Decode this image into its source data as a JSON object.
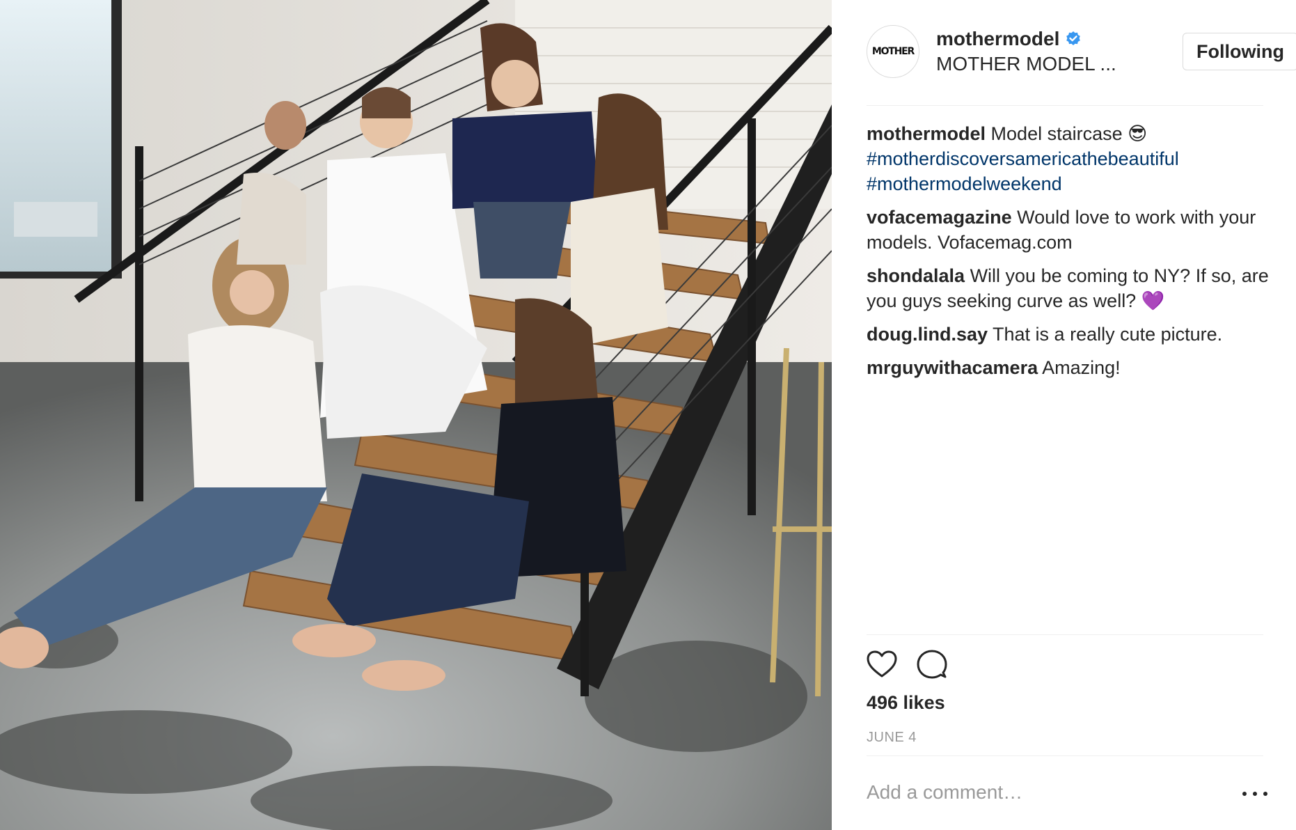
{
  "post": {
    "username": "mothermodel",
    "full_name": "MOTHER MODEL ...",
    "avatar_text": "MOTHER",
    "verified_icon": "verified-badge-icon",
    "follow_label": "Following",
    "caption": {
      "user": "mothermodel",
      "text": "Model staircase 😎",
      "tags": [
        "#motherdiscoversamericathebeautiful",
        "#mothermodelweekend"
      ]
    },
    "comments": [
      {
        "user": "vofacemagazine",
        "text": "Would love to work with your models. Vofacemag.com"
      },
      {
        "user": "shondalala",
        "text": "Will you be coming to NY? If so, are you guys seeking curve as well? 💜"
      },
      {
        "user": "doug.lind.say",
        "text": "That is a really cute picture."
      },
      {
        "user": "mrguywithacamera",
        "text": "Amazing!"
      }
    ],
    "actions": {
      "like_icon": "heart-outline-icon",
      "comment_icon": "speech-bubble-icon"
    },
    "likes": "496 likes",
    "date": "JUNE 4",
    "add_comment_placeholder": "Add a comment…",
    "more_icon": "more-options-icon"
  },
  "photo": {
    "description_icon": "post-photo"
  },
  "colors": {
    "text": "#262626",
    "hashtag": "#003569",
    "muted": "#999999",
    "border": "#dbdbdb",
    "verified": "#3897f0"
  }
}
